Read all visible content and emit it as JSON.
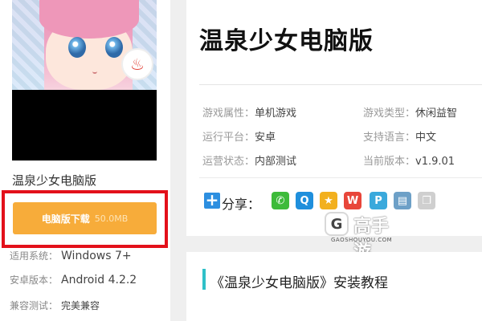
{
  "left": {
    "game_name": "温泉少女电脑版",
    "cover_badge": "♨",
    "download": {
      "label": "电脑版下载",
      "size": "50.0MB"
    },
    "meta": [
      {
        "label": "适用系统：",
        "value": "Windows 7+"
      },
      {
        "label": "安卓版本：",
        "value": "Android 4.2.2"
      },
      {
        "label": "兼容测试：",
        "value": "完美兼容"
      }
    ]
  },
  "main": {
    "title": "温泉少女电脑版",
    "attributes": [
      {
        "label": "游戏属性：",
        "value": "单机游戏"
      },
      {
        "label": "游戏类型：",
        "value": "休闲益智"
      },
      {
        "label": "运行平台：",
        "value": "安卓"
      },
      {
        "label": "支持语言：",
        "value": "中文"
      },
      {
        "label": "运营状态：",
        "value": "内部测试"
      },
      {
        "label": "当前版本：",
        "value": "v1.9.01"
      }
    ],
    "share_label": "分享：",
    "share_icons": [
      "wechat-icon",
      "qq-icon",
      "qzone-icon",
      "weibo-icon",
      "tencent-weibo-icon",
      "print-icon",
      "copy-icon"
    ]
  },
  "watermark": {
    "brand_cn": "高手游",
    "brand_en": "GAOSHOUYOU.COM",
    "logo_letter": "G"
  },
  "tutorial": {
    "title": "《温泉少女电脑版》安装教程"
  },
  "colors": {
    "download_button": "#f7ac3a",
    "highlight_box": "#e3101a",
    "accent_bar": "#2fc0c8",
    "share_plus": "#2d8fe0"
  }
}
